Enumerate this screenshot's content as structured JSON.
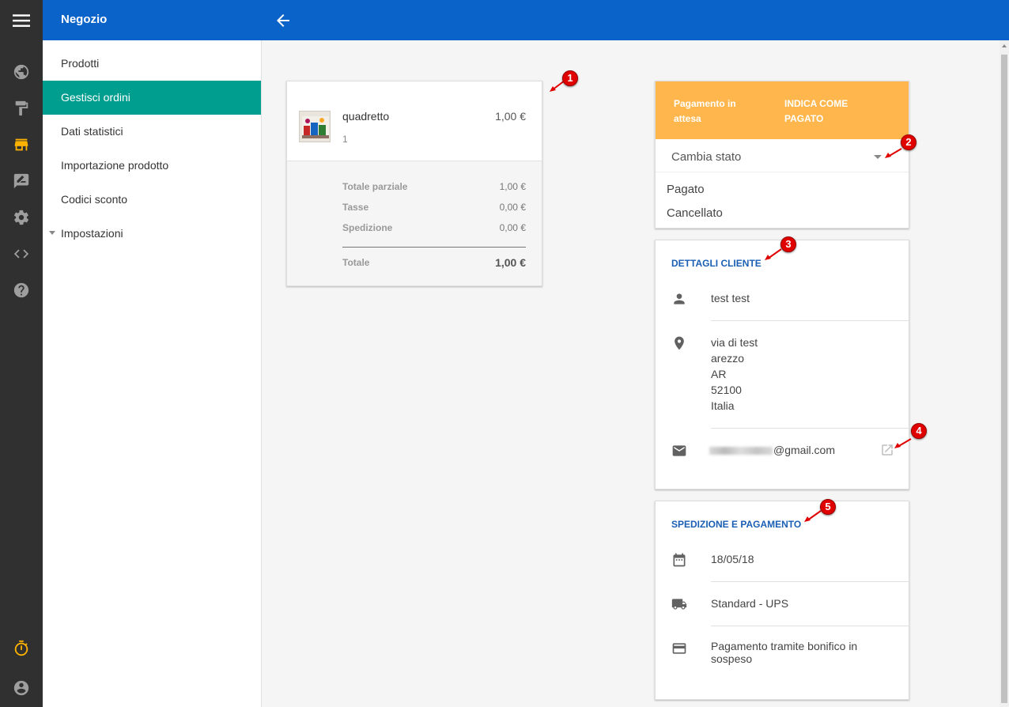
{
  "app": {
    "title": "Negozio"
  },
  "rail": {
    "icons": [
      "menu-icon",
      "globe-icon",
      "paint-roller-icon",
      "store-icon",
      "edit-box-icon",
      "gear-icon",
      "code-icon",
      "help-icon",
      "timer-icon",
      "account-icon"
    ],
    "active": "store-icon",
    "active_color": "#ffb300"
  },
  "sidebar": {
    "items": [
      {
        "label": "Prodotti"
      },
      {
        "label": "Gestisci ordini"
      },
      {
        "label": "Dati statistici"
      },
      {
        "label": "Importazione prodotto"
      },
      {
        "label": "Codici sconto"
      },
      {
        "label": "Impostazioni"
      }
    ],
    "active_index": 1,
    "active_color": "#009e8e"
  },
  "order": {
    "item_name": "quadretto",
    "item_qty": "1",
    "item_price": "1,00 €",
    "subtotal_label": "Totale parziale",
    "subtotal_value": "1,00 €",
    "tax_label": "Tasse",
    "tax_value": "0,00 €",
    "shipping_label": "Spedizione",
    "shipping_value": "0,00 €",
    "total_label": "Totale",
    "total_value": "1,00 €"
  },
  "status": {
    "pending_label": "Pagamento in attesa",
    "mark_paid_label": "INDICA COME PAGATO",
    "change_state_label": "Cambia stato",
    "options": [
      "Pagato",
      "Cancellato"
    ],
    "banner_color": "#ffb74d"
  },
  "customer": {
    "section_title": "DETTAGLI CLIENTE",
    "name": "test test",
    "address_lines": [
      "via di test",
      "arezzo",
      "AR",
      "52100",
      "Italia"
    ],
    "email_domain": "@gmail.com"
  },
  "shipping": {
    "section_title": "SPEDIZIONE E PAGAMENTO",
    "date": "18/05/18",
    "method": "Standard - UPS",
    "payment": "Pagamento tramite bonifico in sospeso"
  },
  "annotations": [
    "1",
    "2",
    "3",
    "4",
    "5"
  ],
  "theme": {
    "topbar": "#0a63c9",
    "rail": "#303030",
    "section_title": "#1a5fb4",
    "annotation": "#e00000"
  }
}
